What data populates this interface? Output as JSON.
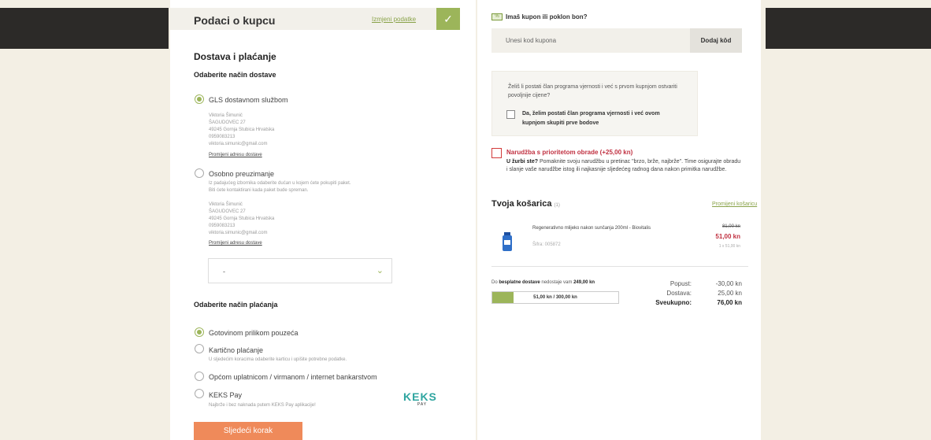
{
  "buyer": {
    "title": "Podaci o kupcu",
    "edit_link": "Izmjeni podatke"
  },
  "delivery": {
    "section_title": "Dostava i plaćanje",
    "subtitle": "Odaberite način dostave",
    "options": [
      {
        "label": "GLS dostavnom službom",
        "selected": true,
        "address": [
          "Viktoria Šimunić",
          "ŠAGUDOVEC 27",
          "49245 Gornja Stubica Hrvatska",
          "0959083213",
          "viktoria.simunic@gmail.com"
        ],
        "change_link": "Promijeni adresu dostave"
      },
      {
        "label": "Osobno preuzimanje",
        "selected": false,
        "description": [
          "Iz padajućeg izbornika odaberite dućan u kojem ćete pokupiti paket.",
          "Biti ćete kontaktirani kada paket bude spreman."
        ],
        "address": [
          "Viktoria Šimunić",
          "ŠAGUDOVEC 27",
          "49245 Gornja Stubica Hrvatska",
          "0959083213",
          "viktoria.simunic@gmail.com"
        ],
        "change_link": "Promijeni adresu dostave"
      }
    ],
    "store_select_value": "-"
  },
  "payment": {
    "subtitle": "Odaberite način plaćanja",
    "options": [
      {
        "label": "Gotovinom prilikom pouzeća",
        "selected": true,
        "description": ""
      },
      {
        "label": "Kartično plaćanje",
        "selected": false,
        "description": "U sljedećim koracima odaberite karticu i upišite potrebne podatke."
      },
      {
        "label": "Općom uplatnicom / virmanom / internet bankarstvom",
        "selected": false,
        "description": ""
      },
      {
        "label": "KEKS Pay",
        "selected": false,
        "description": "Najbrže i bez naknada putem KEKS Pay aplikacije!"
      }
    ],
    "keks_logo": "KEKS",
    "keks_sub": "PAY"
  },
  "next_button": "Sljedeći korak",
  "coupon": {
    "title": "Imaš kupon ili poklon bon?",
    "placeholder": "Unesi kod kupona",
    "button": "Dodaj kôd",
    "icon": "%"
  },
  "loyalty": {
    "text": "Želiš li postati član programa vjernosti i već s prvom kupnjom ostvariti povoljnije cijene?",
    "checkbox_label": "Da, želim postati član programa vjernosti i već ovom kupnjom skupiti prve bodove",
    "checked": false
  },
  "priority": {
    "title": "Narudžba s prioritetom obrade (+25,00 kn)",
    "lead": "U žurbi ste?",
    "text": " Pomaknite svoju narudžbu u pretinac \"brzo, brže, najbrže\". Time osigurajte obradu i slanje vaše narudžbe istog ili najkasnije sljedećeg radnog dana nakon primitka narudžbe.",
    "checked": false
  },
  "cart": {
    "title": "Tvoja košarica",
    "count": "(1)",
    "change_link": "Promijeni košaricu",
    "items": [
      {
        "name": "Regenerativno mlijeko nakon sunčanja 200ml - Biovitalis",
        "sku": "Šifra: 005872",
        "old_price": "81,00 kn",
        "price": "51,00 kn",
        "qty_price": "1 x 51,00 kn"
      }
    ]
  },
  "shipping": {
    "text_pre": "Do ",
    "text_bold": "besplatne dostave",
    "text_mid": " nedostaje vam ",
    "text_amount": "249,00 kn",
    "progress_label": "51,00 kn / 300,00 kn",
    "progress_fraction": 0.17
  },
  "summary": [
    {
      "label": "Popust:",
      "value": "-30,00 kn",
      "bold": false
    },
    {
      "label": "Dostava:",
      "value": "25,00 kn",
      "bold": false
    },
    {
      "label": "Sveukupno:",
      "value": "76,00 kn",
      "bold": true
    }
  ],
  "colors": {
    "accent": "#9cb55a",
    "cta": "#ef8a5a",
    "priority": "#c03040"
  }
}
